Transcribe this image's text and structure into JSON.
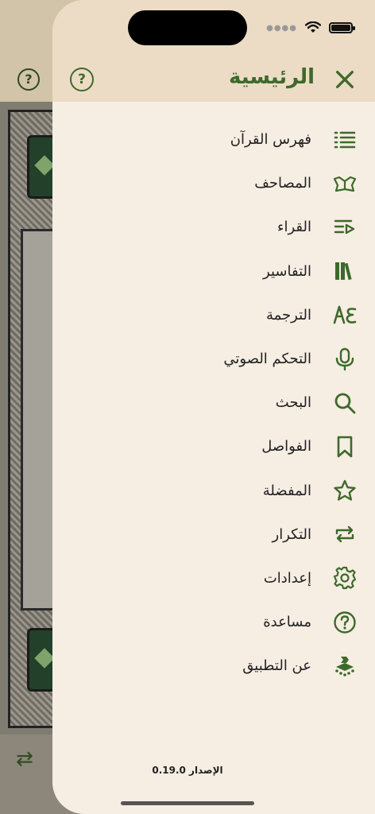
{
  "header": {
    "title": "الرئيسية",
    "close_icon": "close-icon",
    "help_icon": "help-circle-icon",
    "help_glyph": "?"
  },
  "background": {
    "help_glyph": "?",
    "repeat_glyph": "⇄"
  },
  "menu": {
    "items": [
      {
        "label": "فهرس القرآن",
        "icon": "list-icon"
      },
      {
        "label": "المصاحف",
        "icon": "open-book-icon"
      },
      {
        "label": "القراء",
        "icon": "playlist-icon"
      },
      {
        "label": "التفاسير",
        "icon": "books-icon"
      },
      {
        "label": "الترجمة",
        "icon": "translate-icon"
      },
      {
        "label": "التحكم الصوتي",
        "icon": "microphone-icon"
      },
      {
        "label": "البحث",
        "icon": "search-icon"
      },
      {
        "label": "الفواصل",
        "icon": "bookmark-icon"
      },
      {
        "label": "المفضلة",
        "icon": "star-icon"
      },
      {
        "label": "التكرار",
        "icon": "repeat-icon"
      },
      {
        "label": "إعدادات",
        "icon": "gear-icon"
      },
      {
        "label": "مساعدة",
        "icon": "help-circle-icon"
      },
      {
        "label": "عن التطبيق",
        "icon": "app-logo-icon"
      }
    ]
  },
  "footer": {
    "version": "الإصدار 0.19.0"
  },
  "colors": {
    "accent": "#3d6a2a",
    "header_bg": "#ecdcc5",
    "drawer_bg": "#f6ede3"
  }
}
